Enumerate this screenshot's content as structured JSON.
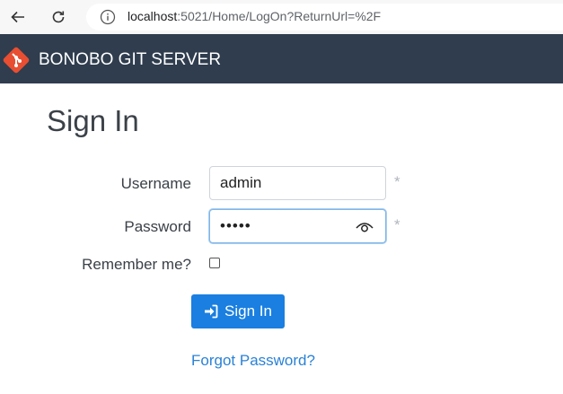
{
  "browser": {
    "url_host": "localhost",
    "url_rest": ":5021/Home/LogOn?ReturnUrl=%2F",
    "back_icon": "back-arrow-icon",
    "refresh_icon": "refresh-icon",
    "info_icon": "info-icon"
  },
  "navbar": {
    "brand": "BONOBO GIT SERVER",
    "logo_icon": "git-logo-icon",
    "background": "#2f3d4e"
  },
  "form": {
    "title": "Sign In",
    "username_label": "Username",
    "username_value": "admin",
    "password_label": "Password",
    "password_mask": "•••••",
    "required_marker": "*",
    "remember_label": "Remember me?",
    "remember_checked": false,
    "signin_label": "Sign In",
    "signin_icon": "sign-in-icon",
    "forgot_label": "Forgot Password?"
  },
  "colors": {
    "accent": "#1a7fe0",
    "link": "#2a82d6"
  }
}
